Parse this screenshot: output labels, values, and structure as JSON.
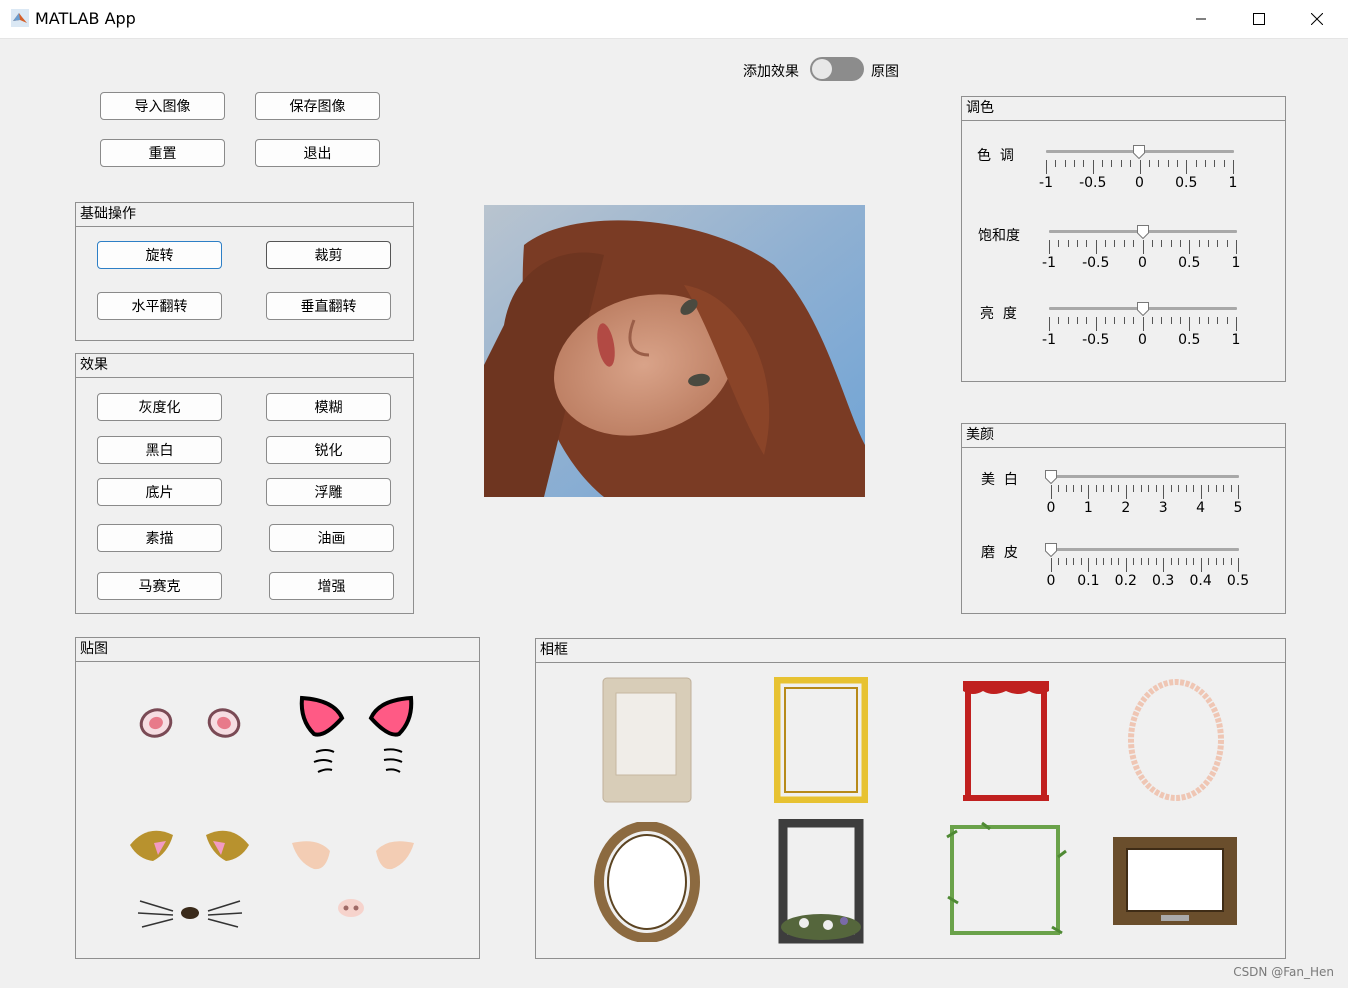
{
  "window": {
    "title": "MATLAB App",
    "icon": "matlab-logo-icon"
  },
  "toggle": {
    "left_label": "添加效果",
    "right_label": "原图"
  },
  "top_buttons": {
    "import": "导入图像",
    "save": "保存图像",
    "reset": "重置",
    "exit": "退出"
  },
  "basic": {
    "title": "基础操作",
    "rotate": "旋转",
    "crop": "裁剪",
    "hflip": "水平翻转",
    "vflip": "垂直翻转"
  },
  "effects": {
    "title": "效果",
    "gray": "灰度化",
    "blur": "模糊",
    "bw": "黑白",
    "sharpen": "锐化",
    "negative": "底片",
    "emboss": "浮雕",
    "sketch": "素描",
    "oil": "油画",
    "mosaic": "马赛克",
    "enhance": "增强"
  },
  "color_panel": {
    "title": "调色",
    "sliders": [
      {
        "label": "色  调",
        "min": -1,
        "max": 1,
        "value": -0.01,
        "ticks": [
          "-1",
          "-0.5",
          "0",
          "0.5",
          "1"
        ]
      },
      {
        "label": "饱和度",
        "min": -1,
        "max": 1,
        "value": 0,
        "ticks": [
          "-1",
          "-0.5",
          "0",
          "0.5",
          "1"
        ]
      },
      {
        "label": "亮  度",
        "min": -1,
        "max": 1,
        "value": 0,
        "ticks": [
          "-1",
          "-0.5",
          "0",
          "0.5",
          "1"
        ]
      }
    ]
  },
  "beauty_panel": {
    "title": "美颜",
    "sliders": [
      {
        "label": "美  白",
        "min": 0,
        "max": 5,
        "value": 0,
        "ticks": [
          "0",
          "1",
          "2",
          "3",
          "4",
          "5"
        ]
      },
      {
        "label": "磨  皮",
        "min": 0,
        "max": 0.5,
        "value": 0,
        "ticks": [
          "0",
          "0.1",
          "0.2",
          "0.3",
          "0.4",
          "0.5"
        ]
      }
    ]
  },
  "stickers": {
    "title": "贴图"
  },
  "frames": {
    "title": "相框"
  },
  "watermark": "CSDN @Fan_Hen"
}
